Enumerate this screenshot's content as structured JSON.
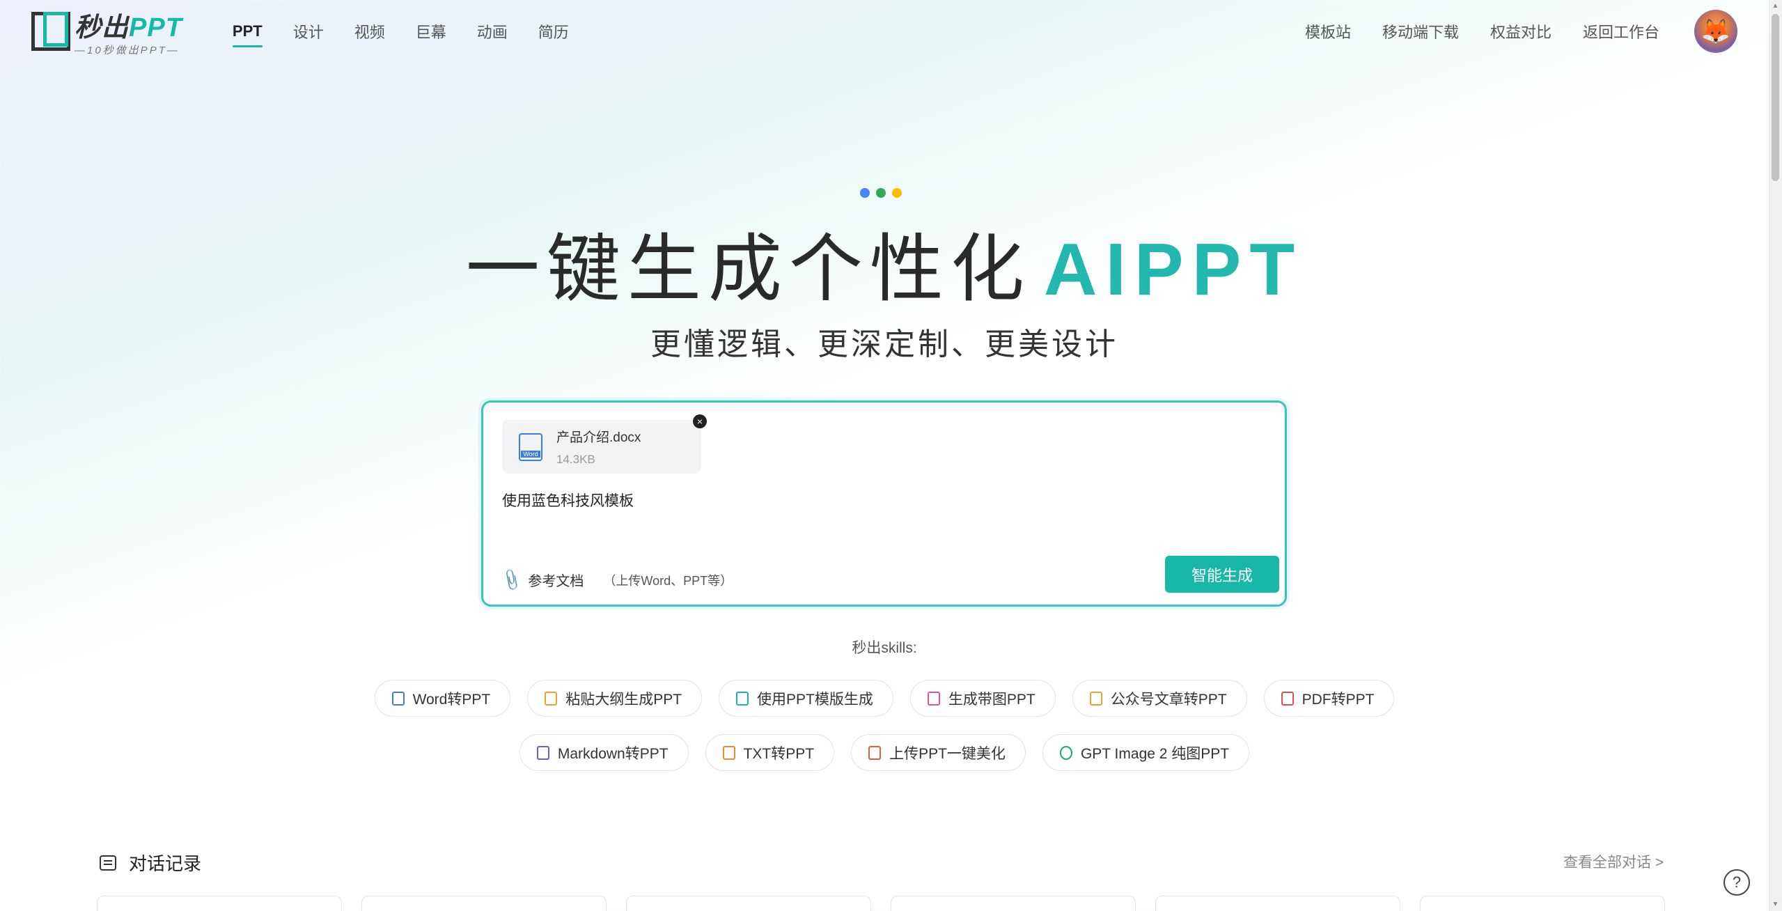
{
  "logo": {
    "brand": "秒出",
    "ppt": "PPT",
    "tagline": "—10秒做出PPT—"
  },
  "nav": {
    "items": [
      "PPT",
      "设计",
      "视频",
      "巨幕",
      "动画",
      "简历"
    ],
    "active": 0
  },
  "right_nav": {
    "items": [
      "模板站",
      "移动端下载",
      "权益对比",
      "返回工作台"
    ]
  },
  "hero": {
    "title": "一键生成个性化",
    "title_accent": "AIPPT",
    "subtitle": "更懂逻辑、更深定制、更美设计",
    "dot_colors": [
      "#4285f4",
      "#34a853",
      "#fbbc05"
    ]
  },
  "input": {
    "file_name": "产品介绍.docx",
    "file_size": "14.3KB",
    "file_badge": "Word",
    "prompt": "使用蓝色科技风模板",
    "ref_label": "参考文档",
    "ref_hint": "（上传Word、PPT等）",
    "generate": "智能生成"
  },
  "skills": {
    "label": "秒出skills:",
    "row1": [
      {
        "label": "Word转PPT",
        "icon": "word-icon",
        "color": "#3d7be0"
      },
      {
        "label": "粘贴大纲生成PPT",
        "icon": "outline-icon",
        "color": "#f0a030"
      },
      {
        "label": "使用PPT模版生成",
        "icon": "template-icon",
        "color": "#18b7a7"
      },
      {
        "label": "生成带图PPT",
        "icon": "image-ppt-icon",
        "color": "#e0559a"
      },
      {
        "label": "公众号文章转PPT",
        "icon": "article-icon",
        "color": "#f0a030"
      },
      {
        "label": "PDF转PPT",
        "icon": "pdf-icon",
        "color": "#e05050"
      }
    ],
    "row2": [
      {
        "label": "Markdown转PPT",
        "icon": "markdown-icon",
        "color": "#6a5be0"
      },
      {
        "label": "TXT转PPT",
        "icon": "txt-icon",
        "color": "#f08a30"
      },
      {
        "label": "上传PPT一键美化",
        "icon": "beautify-icon",
        "color": "#e06040"
      },
      {
        "label": "GPT Image 2 纯图PPT",
        "icon": "gpt-icon",
        "color": "#18a878"
      }
    ]
  },
  "history": {
    "title": "对话记录",
    "view_all": "查看全部对话 >"
  },
  "help": "?"
}
